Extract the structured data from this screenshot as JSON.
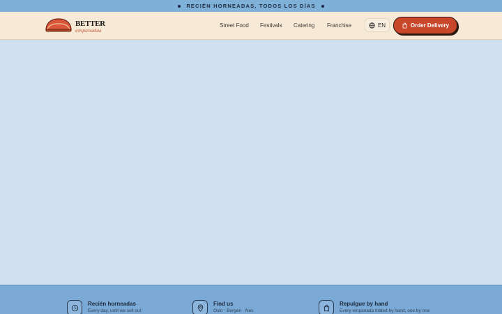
{
  "announcement": {
    "text": "RECIÉN HORNEADAS, TODOS LOS DÍAS"
  },
  "brand": {
    "name": "BETTER",
    "tagline": "empanadas",
    "accent": "#c8462a"
  },
  "nav": {
    "links": [
      {
        "label": "Street Food"
      },
      {
        "label": "Festivals"
      },
      {
        "label": "Catering"
      },
      {
        "label": "Franchise"
      }
    ],
    "language": {
      "label": "EN",
      "icon": "globe-icon"
    },
    "order": {
      "label": "Order Delivery",
      "icon": "shopping-bag-icon"
    }
  },
  "features": [
    {
      "title": "Recién horneadas",
      "desc": "Every day, until we sell out",
      "icon": "clock-icon"
    },
    {
      "title": "Find us",
      "desc": "Oslo · Bergen · Nes",
      "icon": "map-pin-icon"
    },
    {
      "title": "Repulgue by hand",
      "desc": "Every empanada folded by hand, one by one",
      "icon": "shopping-bag-icon"
    }
  ]
}
